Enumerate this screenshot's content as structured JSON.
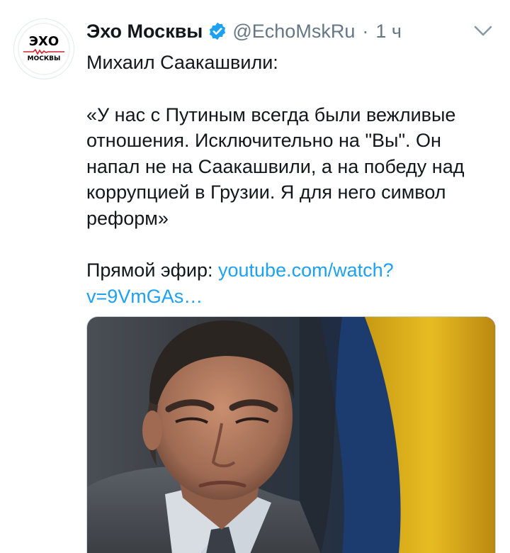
{
  "tweet": {
    "avatar": {
      "top_text": "ЭХО",
      "bottom_text": "МОСКВЫ"
    },
    "author": {
      "name": "Эхо Москвы",
      "verified": true,
      "handle": "@EchoMskRu",
      "separator": "·",
      "time": "1 ч"
    },
    "menu_icon": "chevron-down-icon",
    "text": {
      "line1": "Михаил Саакашвили:",
      "quote": "«У нас с Путиным всегда были вежливые отношения. Исключительно на \"Вы\". Он напал не на Саакашвили, а на победу над коррупцией в Грузии. Я для него символ реформ»",
      "live_label": "Прямой эфир: ",
      "link": "youtube.com/watch?v=9VmGAs…"
    },
    "media": {
      "type": "photo"
    }
  },
  "colors": {
    "link": "#1da1f2",
    "secondary": "#657786",
    "verified": "#1da1f2",
    "primary_text": "#14171a",
    "logo_red": "#d6202b"
  }
}
